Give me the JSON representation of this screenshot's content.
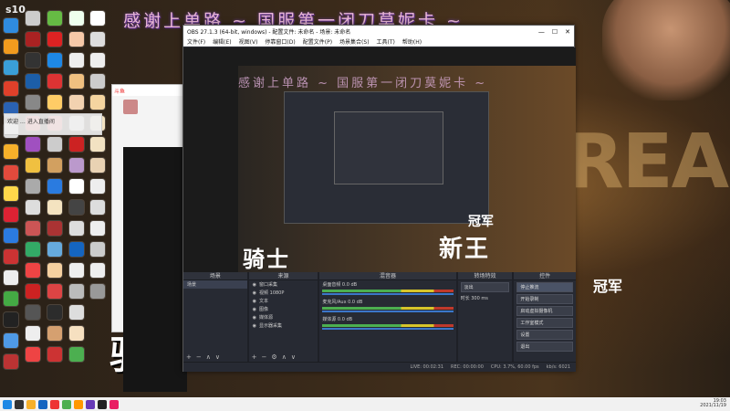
{
  "brand": "s10",
  "banner": "感谢上单路 ~ 国服第一闭刀莫妮卡 ~",
  "banner_repeat": "感谢上单路 ~ 国服第一闭刀莫妮卡 ~",
  "stream_text": {
    "knight": "骑士",
    "newking": "新王",
    "champion": "冠军",
    "ghost": "BREAK"
  },
  "chat_window": {
    "title": "斗鱼",
    "notify": "欢迎 … 进入直播间"
  },
  "obs": {
    "title": "OBS 27.1.3 (64-bit, windows) - 配置文件: 未命名 - 场景: 未命名",
    "menu": [
      "文件(F)",
      "编辑(E)",
      "视图(V)",
      "停靠窗口(D)",
      "配置文件(P)",
      "场景集合(S)",
      "工具(T)",
      "帮助(H)"
    ],
    "panels": {
      "scenes": "场景",
      "sources": "来源",
      "mixer": "混音器",
      "transitions": "转场特效",
      "controls": "控件"
    },
    "scene_items": [
      "场景"
    ],
    "source_items": [
      "窗口采集",
      "视频 1080P",
      "文本",
      "图像",
      "媒体源",
      "显示器采集"
    ],
    "mixer_channels": [
      {
        "name": "桌面音频",
        "db": "0.0 dB",
        "level": 0.85
      },
      {
        "name": "麦克风/Aux",
        "db": "0.0 dB",
        "level": 0.7
      },
      {
        "name": "媒体源",
        "db": "0.0 dB",
        "level": 0.6
      }
    ],
    "transition": {
      "type": "淡出",
      "duration_label": "时长",
      "duration": "300 ms"
    },
    "controls": [
      "停止推流",
      "开始录制",
      "启动虚拟摄像机",
      "工作室模式",
      "设置",
      "退出"
    ],
    "status": [
      "LIVE: 00:02:31",
      "REC: 00:00:00",
      "CPU: 3.7%, 60.00 fps",
      "kb/s: 6021"
    ]
  },
  "clock": {
    "time": "19:03",
    "date": "2021/11/19"
  }
}
